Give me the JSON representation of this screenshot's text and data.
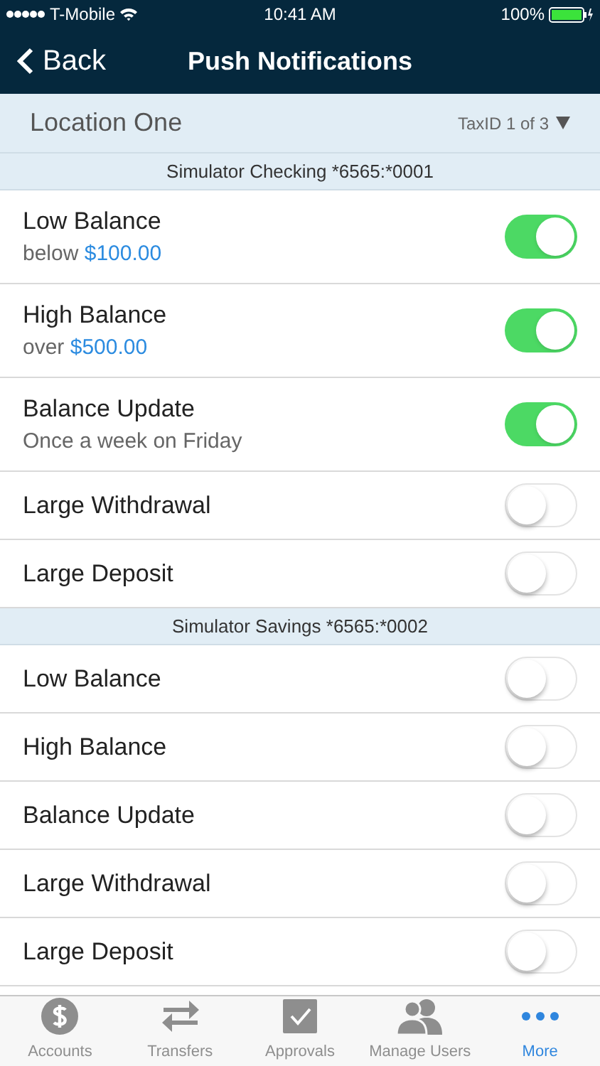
{
  "status_bar": {
    "carrier": "T-Mobile",
    "time": "10:41 AM",
    "battery": "100%"
  },
  "nav": {
    "back": "Back",
    "title": "Push Notifications"
  },
  "location": {
    "name": "Location One",
    "tax_id": "TaxID 1 of 3"
  },
  "sections": [
    {
      "title": "Simulator Checking *6565:*0001",
      "alerts": [
        {
          "label": "Low Balance",
          "detail": "below",
          "amount": "$100.00",
          "on": true
        },
        {
          "label": "High Balance",
          "detail": "over",
          "amount": "$500.00",
          "on": true
        },
        {
          "label": "Balance Update",
          "detail": "Once a week on Friday",
          "on": true
        },
        {
          "label": "Large Withdrawal",
          "on": false
        },
        {
          "label": "Large Deposit",
          "on": false
        }
      ]
    },
    {
      "title": "Simulator Savings *6565:*0002",
      "alerts": [
        {
          "label": "Low Balance",
          "on": false
        },
        {
          "label": "High Balance",
          "on": false
        },
        {
          "label": "Balance Update",
          "on": false
        },
        {
          "label": "Large Withdrawal",
          "on": false
        },
        {
          "label": "Large Deposit",
          "on": false
        }
      ]
    }
  ],
  "tab_bar": [
    {
      "label": "Accounts",
      "kind": "dollar",
      "selected": false
    },
    {
      "label": "Transfers",
      "kind": "arrows",
      "selected": false
    },
    {
      "label": "Approvals",
      "kind": "check",
      "selected": false
    },
    {
      "label": "Manage Users",
      "kind": "users",
      "selected": false
    },
    {
      "label": "More",
      "kind": "more",
      "selected": true
    }
  ]
}
